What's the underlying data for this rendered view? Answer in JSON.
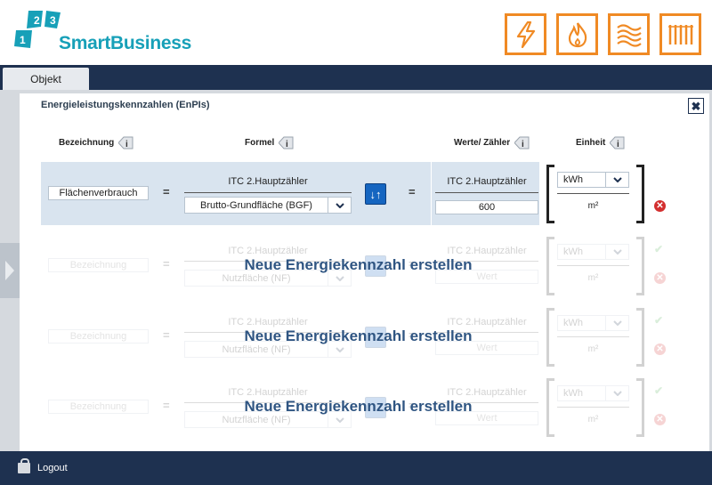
{
  "brand": {
    "name": "SmartBusiness",
    "logo_digits": [
      "1",
      "2",
      "3"
    ]
  },
  "energy_icons": [
    "lightning-icon",
    "flame-icon",
    "heat-waves-icon",
    "radiator-icon"
  ],
  "colors": {
    "accent_orange": "#f08a24",
    "navy": "#1e3150",
    "teal": "#17a0b8",
    "button_blue": "#1565c0",
    "delete_red": "#d32f2f"
  },
  "nav": {
    "tab_label": "Objekt"
  },
  "panel": {
    "title": "Energieleistungskennzahlen (EnPIs)",
    "close": "✖",
    "columns": {
      "bezeichnung": "Bezeichnung",
      "formel": "Formel",
      "werte": "Werte/ Zähler",
      "einheit": "Einheit"
    }
  },
  "rows": [
    {
      "name": "Flächenverbrauch",
      "numerator": "ITC 2.Hauptzähler",
      "denominator_select": "Brutto-Grundfläche (BGF)",
      "werte_label": "ITC 2.Hauptzähler",
      "werte_value": "600",
      "unit_select": "kWh",
      "unit_denominator": "m²"
    }
  ],
  "ghost_rows": [
    {
      "placeholder": "Bezeichnung",
      "numerator": "ITC 2.Hauptzähler",
      "denominator_select": "Nutzfläche (NF)",
      "werte_label": "ITC 2.Hauptzähler",
      "werte_value": "Wert",
      "unit_select": "kWh",
      "unit_denominator": "m²",
      "overlay": "Neue Energiekennzahl erstellen"
    },
    {
      "placeholder": "Bezeichnung",
      "numerator": "ITC 2.Hauptzähler",
      "denominator_select": "Nutzfläche (NF)",
      "werte_label": "ITC 2.Hauptzähler",
      "werte_value": "Wert",
      "unit_select": "kWh",
      "unit_denominator": "m²",
      "overlay": "Neue Energiekennzahl erstellen"
    },
    {
      "placeholder": "Bezeichnung",
      "numerator": "ITC 2.Hauptzähler",
      "denominator_select": "Nutzfläche (NF)",
      "werte_label": "ITC 2.Hauptzähler",
      "werte_value": "Wert",
      "unit_select": "kWh",
      "unit_denominator": "m²",
      "overlay": "Neue Energiekennzahl erstellen"
    }
  ],
  "symbols": {
    "equals": "=",
    "swap": "↓↑",
    "delete": "✕",
    "ok": "✔",
    "chevron": "⌄"
  },
  "footer": {
    "logout_label": "Logout"
  }
}
